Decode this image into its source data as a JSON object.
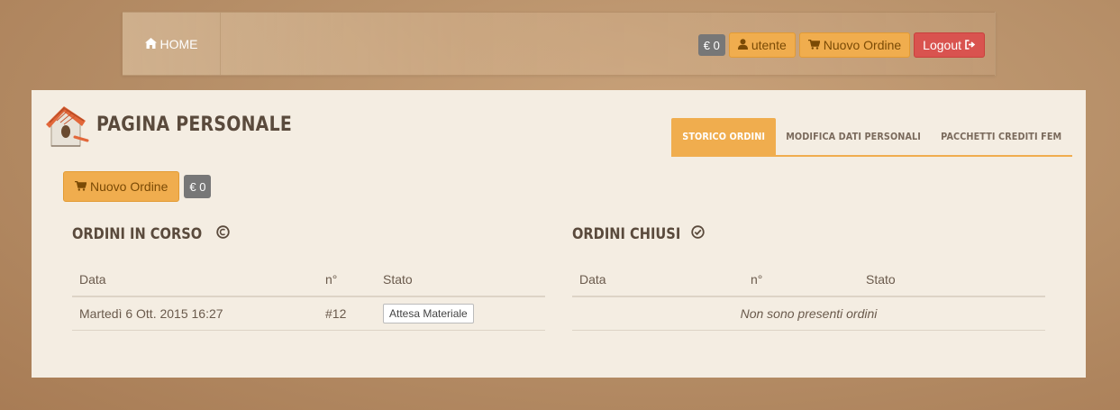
{
  "navbar": {
    "home_label": "HOME",
    "credit": "€ 0",
    "user_label": "utente",
    "new_order_label": "Nuovo Ordine",
    "logout_label": "Logout"
  },
  "page": {
    "title": "PAGINA PERSONALE",
    "tabs": [
      {
        "label": "STORICO ORDINI",
        "active": true
      },
      {
        "label": "MODIFICA DATI PERSONALI",
        "active": false
      },
      {
        "label": "PACCHETTI CREDITI FEM",
        "active": false
      }
    ],
    "new_order_label": "Nuovo Ordine",
    "credit": "€ 0"
  },
  "open_orders": {
    "title": "ORDINI IN CORSO",
    "columns": [
      "Data",
      "n°",
      "Stato"
    ],
    "rows": [
      {
        "date": "Martedì 6 Ott. 2015 16:27",
        "number": "#12",
        "status": "Attesa Materiale"
      }
    ]
  },
  "closed_orders": {
    "title": "ORDINI CHIUSI",
    "columns": [
      "Data",
      "n°",
      "Stato"
    ],
    "empty_message": "Non sono presenti ordini"
  },
  "colors": {
    "accent": "#f0ad4e",
    "danger": "#d9534f",
    "panel": "#f4ede2"
  }
}
